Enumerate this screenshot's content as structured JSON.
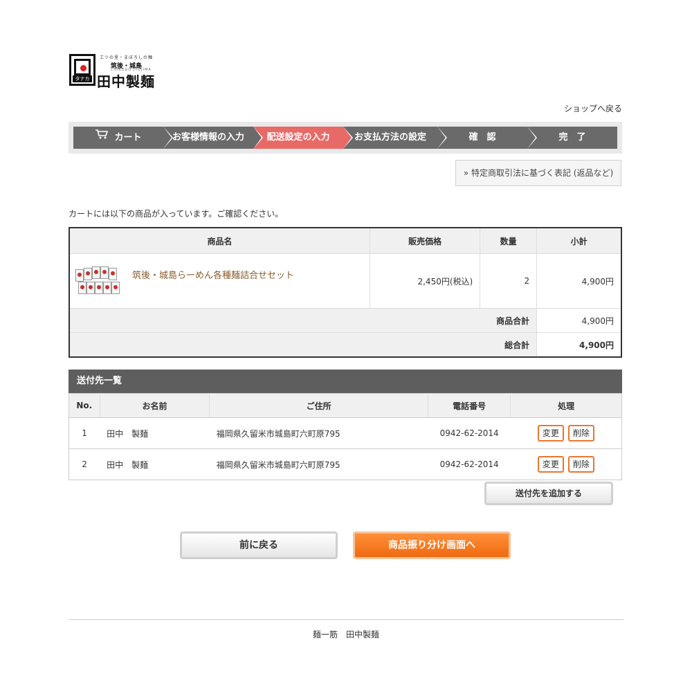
{
  "logo": {
    "tagline": "エツの里・まぼろしの麺",
    "sub": "筑後・城島",
    "roman": "CHIKUGO JYOJIMA",
    "mark_kana": "タナカ",
    "name": "田中製麺"
  },
  "header": {
    "back_to_shop": "ショップへ戻る"
  },
  "steps": [
    {
      "label": "カート",
      "icon": "cart-icon",
      "active": false
    },
    {
      "label": "お客様情報の入力",
      "active": false
    },
    {
      "label": "配送設定の入力",
      "active": true
    },
    {
      "label": "お支払方法の設定",
      "active": false
    },
    {
      "label": "確　認",
      "active": false
    },
    {
      "label": "完　了",
      "active": false
    }
  ],
  "tokutei_link": "» 特定商取引法に基づく表記 (返品など)",
  "intro_text": "カートには以下の商品が入っています。ご確認ください。",
  "cart": {
    "columns": [
      "商品名",
      "販売価格",
      "数量",
      "小計"
    ],
    "items": [
      {
        "name": "筑後・城島らーめん各種麺詰合せセット",
        "price": "2,450円(税込)",
        "qty": "2",
        "subtotal": "4,900円"
      }
    ],
    "goods_total_label": "商品合計",
    "goods_total": "4,900円",
    "grand_total_label": "総合計",
    "grand_total": "4,900円"
  },
  "shipping": {
    "title": "送付先一覧",
    "columns": [
      "No.",
      "お名前",
      "ご住所",
      "電話番号",
      "処理"
    ],
    "rows": [
      {
        "no": "1",
        "name": "田中　製麺",
        "address": "福岡県久留米市城島町六町原795",
        "tel": "0942-62-2014"
      },
      {
        "no": "2",
        "name": "田中　製麺",
        "address": "福岡県久留米市城島町六町原795",
        "tel": "0942-62-2014"
      }
    ],
    "edit_label": "変更",
    "delete_label": "削除",
    "add_label": "送付先を追加する"
  },
  "buttons": {
    "back": "前に戻る",
    "next": "商品振り分け画面へ"
  },
  "footer": {
    "text": "麺一筋　田中製麺"
  },
  "colors": {
    "active_step": "#e86a67",
    "step": "#6a6a6a",
    "next_button": "#f47b20",
    "section_header": "#5e5e5e"
  }
}
